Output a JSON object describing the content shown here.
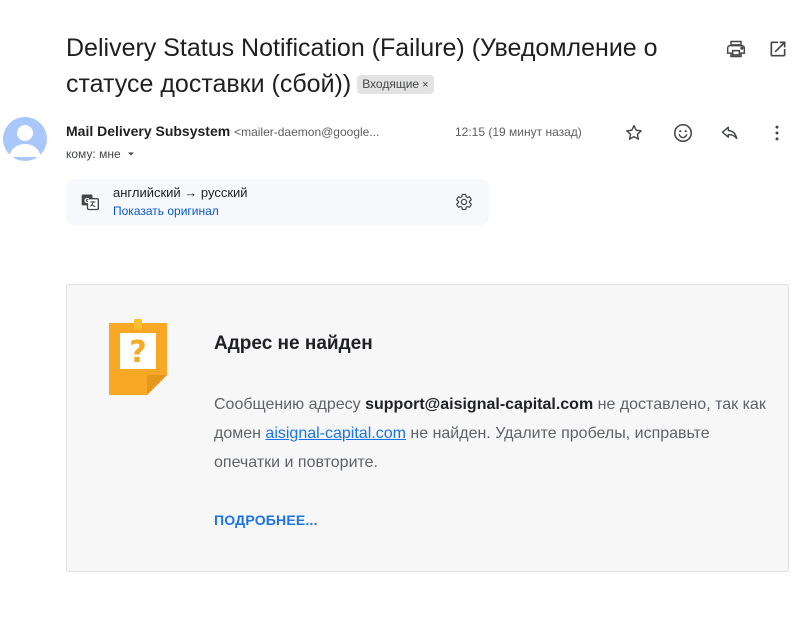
{
  "email": {
    "subject": "Delivery Status Notification (Failure) (Уведомление о статусе доставки (сбой))",
    "label": "Входящие",
    "label_remove": "×",
    "sender_name": "Mail Delivery Subsystem",
    "sender_email": "<mailer-daemon@google...",
    "timestamp": "12:15 (19 минут назад)",
    "recipient": "кому: мне"
  },
  "translation": {
    "languages": "английский → русский",
    "show_original": "Показать оригинал"
  },
  "bounce": {
    "title": "Адрес не найден",
    "text_before": "Сообщению адресу ",
    "address": "support@aisignal-capital.com",
    "text_middle": " не доставлено, так как домен ",
    "domain": "aisignal-capital.com",
    "text_after": " не найден. Удалите пробелы, исправьте опечатки и повторите.",
    "learn_more": "ПОДРОБНЕЕ..."
  },
  "icons": {
    "print": "print-icon",
    "open_new_window": "open-in-new-window-icon",
    "star": "star-icon",
    "emoji": "emoji-reaction-icon",
    "reply": "reply-icon",
    "more": "more-vert-icon",
    "dropdown": "chevron-down-icon",
    "translate": "translate-icon",
    "settings": "gear-icon",
    "bounce": "question-note-icon"
  },
  "colors": {
    "link": "#1a73e8",
    "gmail_link": "#0b57d0",
    "note_orange": "#f9a825",
    "avatar": "#a8c7fa"
  }
}
